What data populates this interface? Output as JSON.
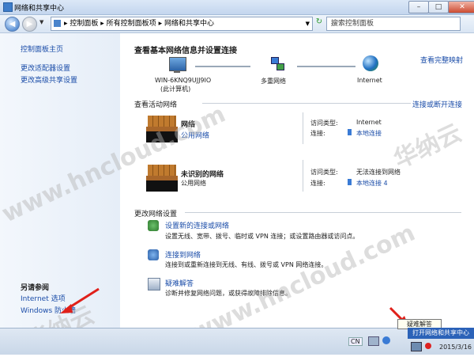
{
  "window": {
    "title": "网络和共享中心",
    "min": "–",
    "max": "□",
    "close": "✕"
  },
  "address": {
    "path": [
      "控制面板",
      "所有控制面板项",
      "网络和共享中心"
    ],
    "refresh": "↻",
    "search_placeholder": "搜索控制面板"
  },
  "left": {
    "home": "控制面板主页",
    "links": [
      "更改适配器设置",
      "更改高级共享设置"
    ],
    "see_also_title": "另请参阅",
    "see_also": [
      "Internet 选项",
      "Windows 防火墙"
    ]
  },
  "main": {
    "title": "查看基本网络信息并设置连接",
    "full_map": "查看完整映射",
    "map": {
      "computer_name": "WIN-6KNQ9UJJ9IO",
      "computer_sub": "(此计算机)",
      "multi": "多重网络",
      "internet": "Internet"
    },
    "active_title": "查看活动网络",
    "connect_link": "连接或断开连接",
    "networks": [
      {
        "name": "网络",
        "type": "公用网络",
        "access_label": "访问类型:",
        "access": "Internet",
        "conn_label": "连接:",
        "conn": "本地连接"
      },
      {
        "name": "未识别的网络",
        "type": "公用网络",
        "access_label": "访问类型:",
        "access": "无法连接到网络",
        "conn_label": "连接:",
        "conn": "本地连接 4"
      }
    ],
    "settings_title": "更改网络设置",
    "tasks": [
      {
        "title": "设置新的连接或网络",
        "desc": "设置无线、宽带、拨号、临时或 VPN 连接；或设置路由器或访问点。"
      },
      {
        "title": "连接到网络",
        "desc": "连接到或重新连接到无线、有线、拨号或 VPN 网络连接。"
      },
      {
        "title": "疑难解答",
        "desc": "诊断并修复网络问题，或获得故障排除信息。"
      }
    ]
  },
  "taskbar": {
    "lang": "CN",
    "date": "2015/3/16",
    "tooltip": "疑难解答",
    "popup": "打开网络和共享中心"
  },
  "watermarks": [
    "www.hncloud.com",
    "华纳云",
    "www.hncloud.com",
    "华纳云"
  ],
  "colors": {
    "link": "#1a4ca8",
    "popup": "#2b62b8",
    "arrow": "#e0201a"
  }
}
